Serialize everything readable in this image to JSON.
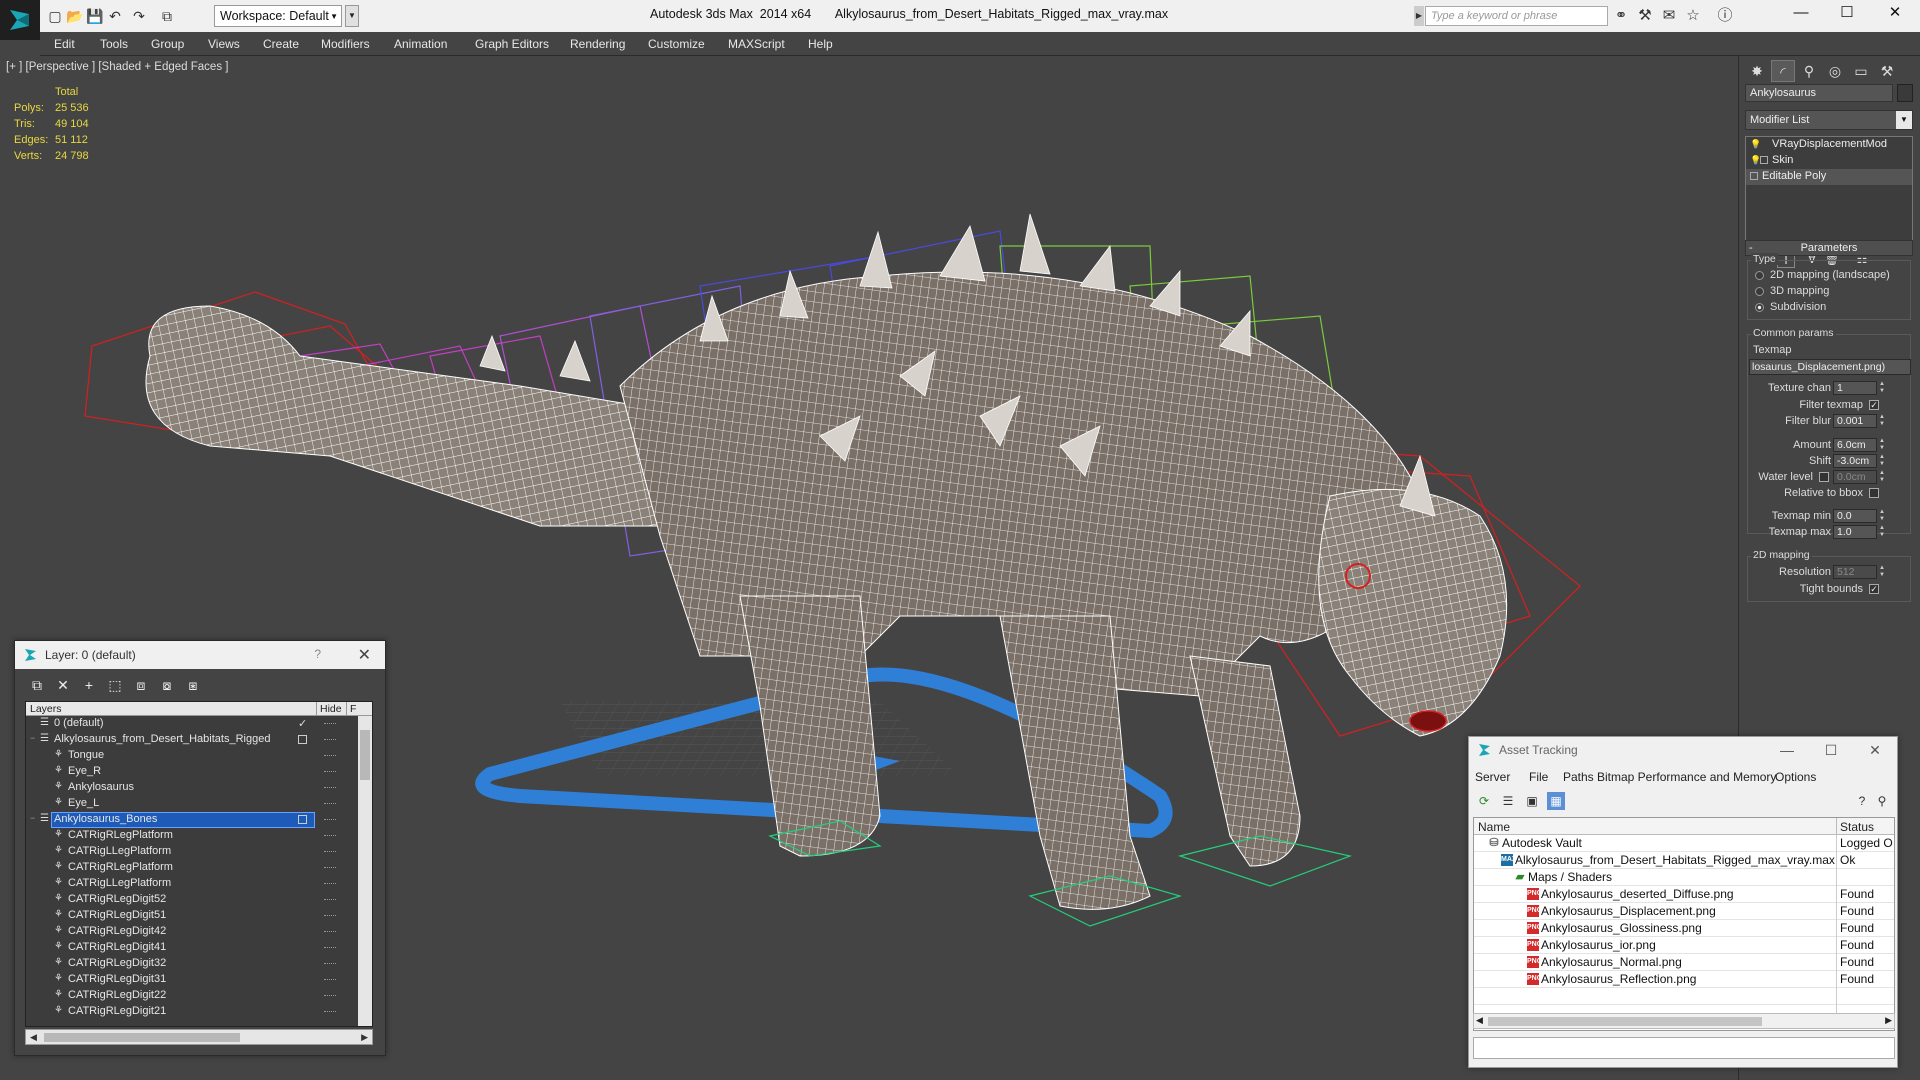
{
  "titlebar": {
    "workspace": "Workspace: Default",
    "app_title": "Autodesk 3ds Max  2014 x64",
    "file_title": "Alkylosaurus_from_Desert_Habitats_Rigged_max_vray.max",
    "search_placeholder": "Type a keyword or phrase"
  },
  "menu": [
    "Edit",
    "Tools",
    "Group",
    "Views",
    "Create",
    "Modifiers",
    "Animation",
    "Graph Editors",
    "Rendering",
    "Customize",
    "MAXScript",
    "Help"
  ],
  "viewport": {
    "label": "[+ ] [Perspective ] [Shaded + Edged Faces ]",
    "stats": {
      "header": "Total",
      "rows": [
        {
          "k": "Polys:",
          "v": "25 536"
        },
        {
          "k": "Tris:",
          "v": "49 104"
        },
        {
          "k": "Edges:",
          "v": "51 112"
        },
        {
          "k": "Verts:",
          "v": "24 798"
        }
      ]
    }
  },
  "command_panel": {
    "object_name": "Ankylosaurus",
    "modifier_list": "Modifier List",
    "stack": [
      "VRayDisplacementMod",
      "Skin",
      "Editable Poly"
    ],
    "parameters_title": "Parameters",
    "type_group": "Type",
    "type_options": [
      "2D mapping (landscape)",
      "3D mapping",
      "Subdivision"
    ],
    "common_group": "Common params",
    "texmap_label": "Texmap",
    "texmap_value": "losaurus_Displacement.png)",
    "texture_chan_label": "Texture chan",
    "texture_chan_value": "1",
    "filter_texmap_label": "Filter texmap",
    "filter_blur_label": "Filter blur",
    "filter_blur_value": "0.001",
    "amount_label": "Amount",
    "amount_value": "6.0cm",
    "shift_label": "Shift",
    "shift_value": "-3.0cm",
    "water_level_label": "Water level",
    "water_level_value": "0.0cm",
    "relative_bbox_label": "Relative to bbox",
    "texmap_min_label": "Texmap min",
    "texmap_min_value": "0.0",
    "texmap_max_label": "Texmap max",
    "texmap_max_value": "1.0",
    "mapping2d_group": "2D mapping",
    "resolution_label": "Resolution",
    "resolution_value": "512",
    "tight_bounds_label": "Tight bounds"
  },
  "layer_window": {
    "title": "Layer: 0 (default)",
    "help": "?",
    "col_layers": "Layers",
    "col_hide": "Hide",
    "col_f": "F",
    "rows": [
      {
        "name": "0 (default)",
        "level": 0,
        "type": "layer",
        "mark": "check"
      },
      {
        "name": "Alkylosaurus_from_Desert_Habitats_Rigged",
        "level": 0,
        "type": "layer",
        "mark": "box",
        "expander": "−"
      },
      {
        "name": "Tongue",
        "level": 1,
        "type": "obj"
      },
      {
        "name": "Eye_R",
        "level": 1,
        "type": "obj"
      },
      {
        "name": "Ankylosaurus",
        "level": 1,
        "type": "obj"
      },
      {
        "name": "Eye_L",
        "level": 1,
        "type": "obj"
      },
      {
        "name": "Ankylosaurus_Bones",
        "level": 0,
        "type": "layer",
        "mark": "box",
        "expander": "−",
        "selected": true
      },
      {
        "name": "CATRigRLegPlatform",
        "level": 1,
        "type": "obj"
      },
      {
        "name": "CATRigLLegPlatform",
        "level": 1,
        "type": "obj"
      },
      {
        "name": "CATRigRLegPlatform",
        "level": 1,
        "type": "obj"
      },
      {
        "name": "CATRigLLegPlatform",
        "level": 1,
        "type": "obj"
      },
      {
        "name": "CATRigRLegDigit52",
        "level": 1,
        "type": "obj"
      },
      {
        "name": "CATRigRLegDigit51",
        "level": 1,
        "type": "obj"
      },
      {
        "name": "CATRigRLegDigit42",
        "level": 1,
        "type": "obj"
      },
      {
        "name": "CATRigRLegDigit41",
        "level": 1,
        "type": "obj"
      },
      {
        "name": "CATRigRLegDigit32",
        "level": 1,
        "type": "obj"
      },
      {
        "name": "CATRigRLegDigit31",
        "level": 1,
        "type": "obj"
      },
      {
        "name": "CATRigRLegDigit22",
        "level": 1,
        "type": "obj"
      },
      {
        "name": "CATRigRLegDigit21",
        "level": 1,
        "type": "obj"
      }
    ]
  },
  "asset_window": {
    "title": "Asset Tracking",
    "menu": [
      "Server",
      "File",
      "Paths",
      "Bitmap Performance and Memory",
      "Options"
    ],
    "col_name": "Name",
    "col_status": "Status",
    "rows": [
      {
        "name": "Autodesk Vault",
        "status": "Logged O",
        "level": 0,
        "icon": "vault"
      },
      {
        "name": "Alkylosaurus_from_Desert_Habitats_Rigged_max_vray.max",
        "status": "Ok",
        "level": 1,
        "icon": "max"
      },
      {
        "name": "Maps / Shaders",
        "status": "",
        "level": 2,
        "icon": "folder"
      },
      {
        "name": "Ankylosaurus_deserted_Diffuse.png",
        "status": "Found",
        "level": 3,
        "icon": "png"
      },
      {
        "name": "Ankylosaurus_Displacement.png",
        "status": "Found",
        "level": 3,
        "icon": "png"
      },
      {
        "name": "Ankylosaurus_Glossiness.png",
        "status": "Found",
        "level": 3,
        "icon": "png"
      },
      {
        "name": "Ankylosaurus_ior.png",
        "status": "Found",
        "level": 3,
        "icon": "png"
      },
      {
        "name": "Ankylosaurus_Normal.png",
        "status": "Found",
        "level": 3,
        "icon": "png"
      },
      {
        "name": "Ankylosaurus_Reflection.png",
        "status": "Found",
        "level": 3,
        "icon": "png"
      }
    ]
  },
  "colors": {
    "viewport_bg": "#444444",
    "stats_text": "#e8d840",
    "selection": "#1e5bb8",
    "wire": "#ffffff",
    "bone_red": "#d42020",
    "bone_blue": "#4a4adc",
    "bone_green": "#7acc3c",
    "bone_magenta": "#c040c0",
    "platform_blue": "#2f7fd6"
  }
}
